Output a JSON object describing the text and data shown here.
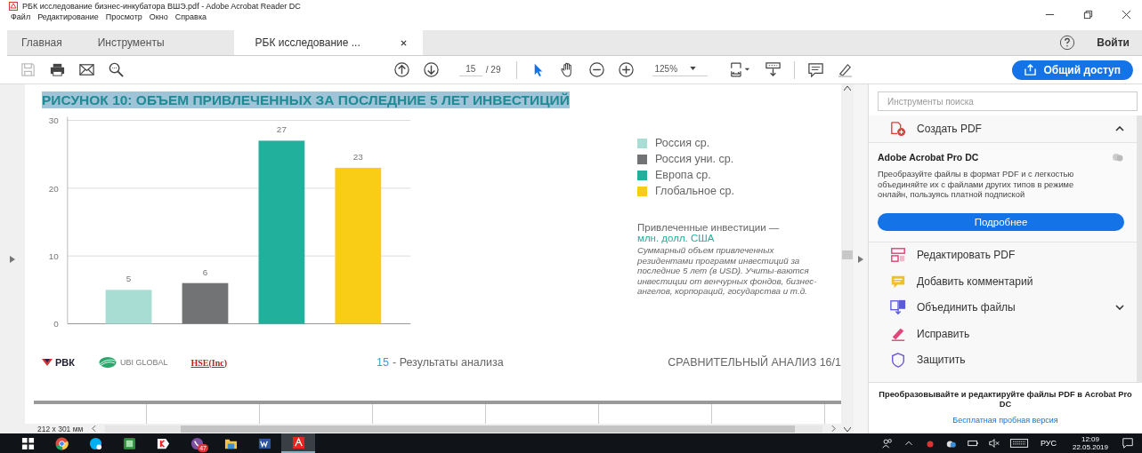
{
  "window": {
    "title": "РБК исследование бизнес-инкубатора ВШЭ.pdf - Adobe Acrobat Reader DC"
  },
  "menu": [
    "Файл",
    "Редактирование",
    "Просмотр",
    "Окно",
    "Справка"
  ],
  "tabs": [
    {
      "label": "Главная",
      "selected": false,
      "closable": false
    },
    {
      "label": "Инструменты",
      "selected": false,
      "closable": false
    },
    {
      "label": "РБК исследование ...",
      "selected": true,
      "closable": true
    }
  ],
  "account": {
    "sign_in": "Войти"
  },
  "toolbar": {
    "page": "15",
    "page_total": "/ 29",
    "zoom": "125%",
    "share": "Общий доступ",
    "pointer_tools": [
      {
        "kind": "select",
        "selected": true
      },
      {
        "kind": "hand",
        "selected": false
      }
    ]
  },
  "document": {
    "figure_title": "РИСУНОК 10: ОБЪЕМ ПРИВЛЕЧЕННЫХ ЗА ПОСЛЕДНИЕ 5 ЛЕТ ИНВЕСТИЦИЙ",
    "chart_data": {
      "type": "bar",
      "ylim": [
        0,
        30
      ],
      "yticks": [
        0,
        10,
        20,
        30
      ],
      "data_labels": true,
      "series": [
        {
          "name": "Россия ср.",
          "color": "#a8ddd3",
          "values": [
            5
          ]
        },
        {
          "name": "Россия уни. ср.",
          "color": "#717374",
          "values": [
            6
          ]
        },
        {
          "name": "Европа ср.",
          "color": "#21b09b",
          "values": [
            27
          ]
        },
        {
          "name": "Глобальное ср.",
          "color": "#f9cc16",
          "values": [
            23
          ]
        }
      ]
    },
    "note_title": "Привлеченные инвестиции —",
    "note_unit": "млн. долл. США",
    "note_text": "Суммарный объем привлеченных резидентами программ инвестиций за последние 5 лет (в USD). Учиты-ваются инвестиции от венчурных фондов, бизнес-ангелов, корпораций, государства и т.д.",
    "footer": {
      "logos": [
        "РВК",
        "UBI GLOBAL",
        "HSE(Inc)"
      ],
      "page_number": "15",
      "section": "- Результаты анализа",
      "running_head": "СРАВНИТЕЛЬНЫЙ АНАЛИЗ 16/1"
    }
  },
  "status_bar": {
    "page_size": "212 x 301 мм"
  },
  "tools_panel": {
    "search": {
      "placeholder": "Инструменты поиска"
    },
    "create_pdf": {
      "label": "Создать PDF",
      "expanded": true
    },
    "promo": {
      "title": "Adobe Acrobat Pro DC",
      "text": "Преобразуйте файлы в формат PDF и с легкостью объединяйте их с файлами других типов в режиме онлайн, пользуясь платной подпиской",
      "button": "Подробнее"
    },
    "tools": [
      {
        "label": "Редактировать PDF",
        "kind": "edit",
        "expandable": false
      },
      {
        "label": "Добавить комментарий",
        "kind": "comment",
        "expandable": false
      },
      {
        "label": "Объединить файлы",
        "kind": "combine",
        "expandable": true
      },
      {
        "label": "Исправить",
        "kind": "fill",
        "expandable": false
      },
      {
        "label": "Защитить",
        "kind": "protect",
        "expandable": false
      }
    ],
    "upsell": {
      "text": "Преобразовывайте и редактируйте файлы PDF в Acrobat Pro DC",
      "link": "Бесплатная пробная версия"
    }
  },
  "taskbar": {
    "apps": [
      {
        "kind": "start",
        "selected": false
      },
      {
        "kind": "chrome",
        "selected": false
      },
      {
        "kind": "skype",
        "selected": false
      },
      {
        "kind": "green",
        "selected": false
      },
      {
        "kind": "yandex",
        "selected": false
      },
      {
        "kind": "viber",
        "selected": false,
        "badge": "47"
      },
      {
        "kind": "folder",
        "selected": false
      },
      {
        "kind": "word",
        "selected": false
      },
      {
        "kind": "acrobat",
        "selected": true
      }
    ],
    "language": "РУС",
    "time": "12:09",
    "date": "22.05.2019"
  }
}
